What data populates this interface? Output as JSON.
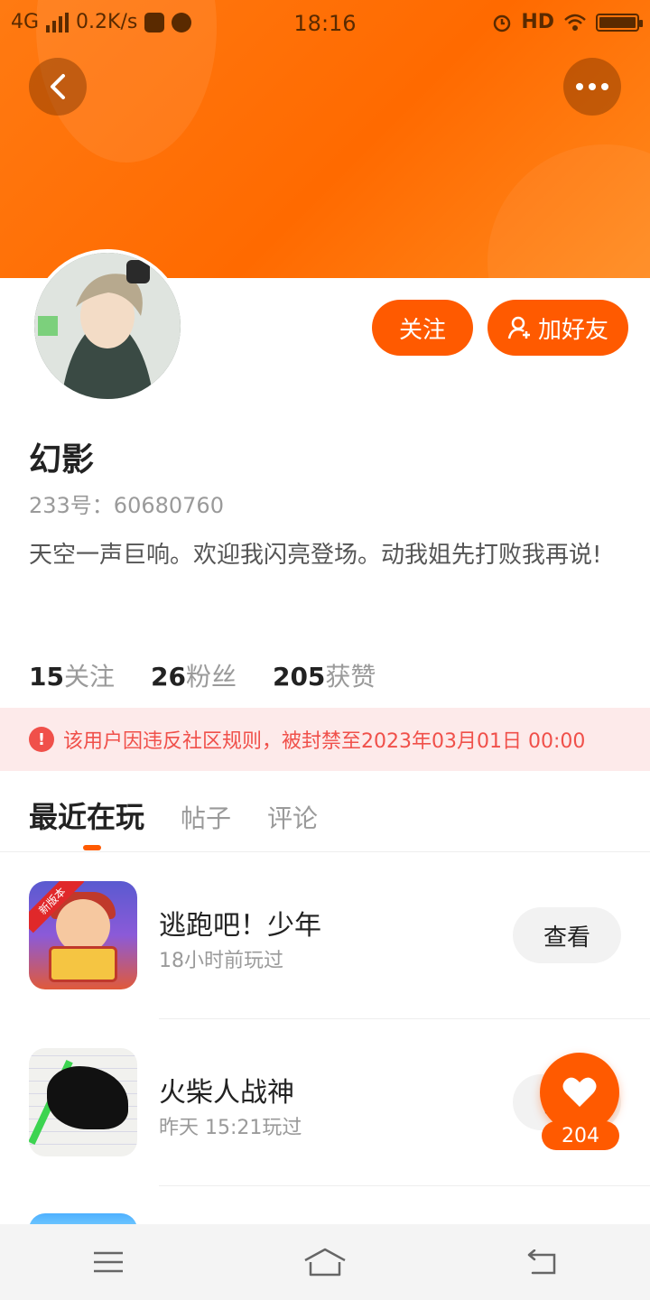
{
  "status_bar": {
    "network": "4G",
    "speed": "0.2K/s",
    "time": "18:16",
    "hd": "HD"
  },
  "header": {
    "back_icon": "chevron-left-icon",
    "more_icon": "more-dots-icon",
    "banner_color": "#ff6a00"
  },
  "profile": {
    "name": "幻影",
    "uid": "233号：60680760",
    "bio": "天空一声巨响。欢迎我闪亮登场。动我姐先打败我再说!",
    "follow_label": "关注",
    "add_friend_label": "加好友",
    "stats": [
      {
        "num": "15",
        "label": "关注"
      },
      {
        "num": "26",
        "label": "粉丝"
      },
      {
        "num": "205",
        "label": "获赞"
      }
    ]
  },
  "ban_notice": {
    "text": "该用户因违反社区规则，被封禁至2023年03月01日 00:00",
    "color": "#f0504a"
  },
  "tabs": [
    {
      "label": "最近在玩",
      "active": true
    },
    {
      "label": "帖子",
      "active": false
    },
    {
      "label": "评论",
      "active": false
    }
  ],
  "games": [
    {
      "title": "逃跑吧！少年",
      "sub": "18小时前玩过",
      "button": "查看",
      "badge": "新版本"
    },
    {
      "title": "火柴人战神",
      "sub": "昨天 15:21玩过",
      "button": "查看"
    }
  ],
  "like": {
    "count": "204",
    "icon": "heart-icon"
  },
  "nav": {
    "menu_icon": "menu-icon",
    "home_icon": "home-icon",
    "back_icon": "back-return-icon"
  },
  "accent": "#ff5a00"
}
